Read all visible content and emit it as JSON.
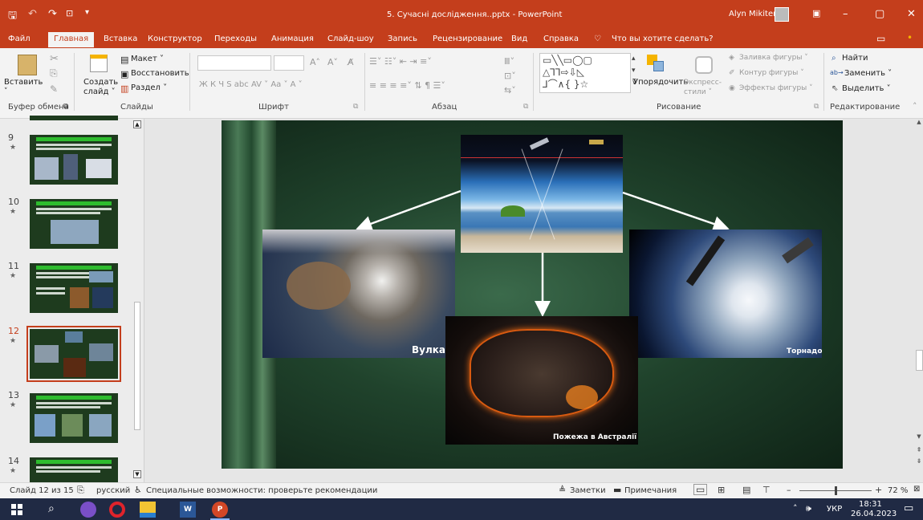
{
  "window": {
    "title": "5. Сучасні дослідження..pptx  -  PowerPoint",
    "user": "Alyn Mikitenko",
    "minimize": "–",
    "restore": "▢",
    "close": "✕"
  },
  "tabs": [
    {
      "label": "Файл"
    },
    {
      "label": "Главная"
    },
    {
      "label": "Вставка"
    },
    {
      "label": "Конструктор"
    },
    {
      "label": "Переходы"
    },
    {
      "label": "Анимация"
    },
    {
      "label": "Слайд-шоу"
    },
    {
      "label": "Запись"
    },
    {
      "label": "Рецензирование"
    },
    {
      "label": "Вид"
    },
    {
      "label": "Справка"
    },
    {
      "label": "Что вы хотите сделать?"
    }
  ],
  "ribbon": {
    "paste": "Вставить",
    "create_slide": "Создать слайд ˅",
    "layout": "Макет ˅",
    "reset": "Восстановить",
    "section": "Раздел ˅",
    "font_tools": "Ж  К  Ч  S  abc  AV ˅  Aa ˅   A ˅",
    "shape_fill": "Заливка фигуры ˅",
    "shape_outline": "Контур фигуры ˅",
    "shape_effects": "Эффекты фигуры ˅",
    "arrange": "Упорядочить",
    "quick_styles": "Экспресс-стили ˅",
    "find": "Найти",
    "replace": "Заменить ˅",
    "select": "Выделить ˅",
    "groups": {
      "clipboard": "Буфер обмена",
      "slides": "Слайды",
      "font": "Шрифт",
      "paragraph": "Абзац",
      "drawing": "Рисование",
      "editing": "Редактирование"
    }
  },
  "thumbnails": [
    {
      "num": "9",
      "star": "★"
    },
    {
      "num": "10",
      "star": "★"
    },
    {
      "num": "11",
      "star": "★"
    },
    {
      "num": "12",
      "star": "★"
    },
    {
      "num": "13",
      "star": "★"
    },
    {
      "num": "14",
      "star": "★"
    }
  ],
  "slide": {
    "captions": {
      "volcano": "Вулкан",
      "tornado": "Торнадо",
      "fire": "Пожежа в Австралії"
    }
  },
  "statusbar": {
    "slide_info": "Слайд 12 из 15",
    "language": "русский",
    "accessibility": "Специальные возможности: проверьте рекомендации",
    "notes": "Заметки",
    "comments": "Примечания",
    "zoom": "72 %"
  },
  "taskbar": {
    "lang": "УКР",
    "time": "18:31",
    "date": "26.04.2023"
  },
  "colors": {
    "accent": "#c43e1c",
    "taskbar": "#202a44",
    "slide_bg": "#20432c"
  }
}
